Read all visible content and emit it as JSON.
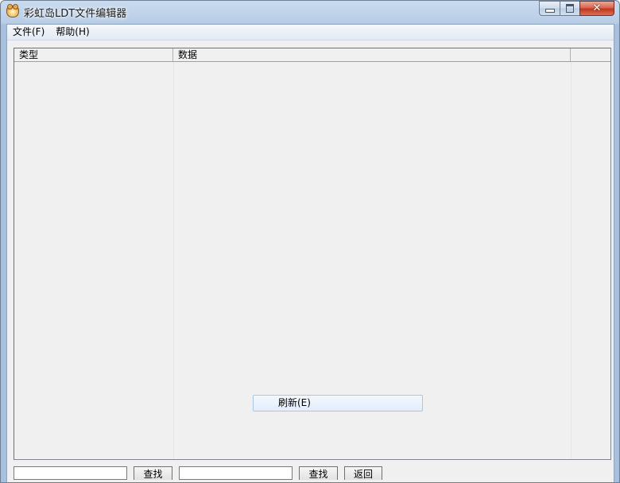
{
  "window": {
    "title": "彩虹岛LDT文件编辑器",
    "app_icon": "bear-icon",
    "close_glyph": "✕"
  },
  "menu": {
    "items": [
      {
        "label": "文件(F)"
      },
      {
        "label": "帮助(H)"
      }
    ]
  },
  "list": {
    "columns": [
      "类型",
      "数据",
      ""
    ],
    "rows": []
  },
  "context": {
    "refresh_label": "刷新(E)"
  },
  "search": {
    "input1_value": "",
    "find1_label": "查找",
    "input2_value": "",
    "find2_label": "查找",
    "back_label": "返回"
  },
  "colors": {
    "titlebar": "#b8cde6",
    "client_bg": "#f0f0f0",
    "close_button": "#c2351b",
    "highlight": "#e3eefa"
  }
}
